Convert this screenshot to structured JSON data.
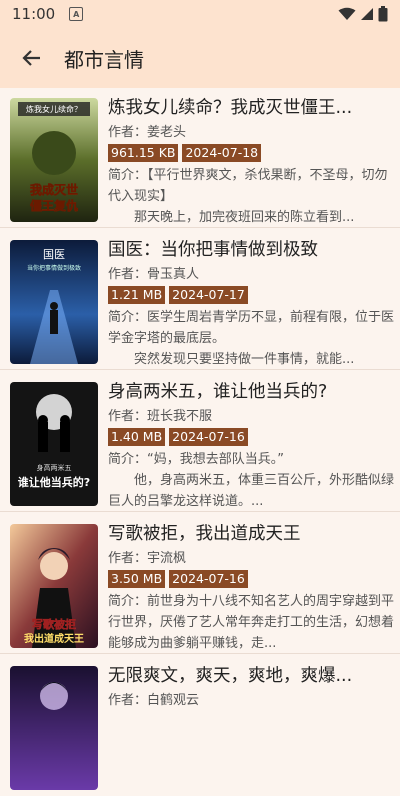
{
  "status": {
    "time": "11:00",
    "sim": "A"
  },
  "appbar": {
    "title": "都市言情"
  },
  "books": [
    {
      "title": "炼我女儿续命？我成灭世僵王...",
      "author": "作者：姜老头",
      "size": "961.15 KB",
      "date": "2024-07-18",
      "intro": "简介：【平行世界爽文，杀伐果断，不圣母，切勿代入现实】\n　　那天晚上，加完夜班回来的陈立看到...",
      "cover_title": "我成灭世僵王复仇",
      "cover_top": "炼我女儿续命？",
      "cover_colors": [
        "#2a2f1a",
        "#6b7a2e"
      ]
    },
    {
      "title": "国医：当你把事情做到极致",
      "author": "作者：骨玉真人",
      "size": "1.21 MB",
      "date": "2024-07-17",
      "intro": "简介：医学生周岩青学历不显，前程有限，位于医学金字塔的最底层。\n　　突然发现只要坚持做一件事情，就能...",
      "cover_title": "国医",
      "cover_top": "当你把事情做到极致",
      "cover_colors": [
        "#0c1b3a",
        "#2b5fa8"
      ]
    },
    {
      "title": "身高两米五，谁让他当兵的?",
      "author": "作者：班长我不服",
      "size": "1.40 MB",
      "date": "2024-07-16",
      "intro": "简介：“妈，我想去部队当兵。”\n　　他，身高两米五，体重三百公斤，外形酷似绿巨人的吕擎龙这样说道。...",
      "cover_title": "谁让他当兵的?",
      "cover_top": "身高两米五",
      "cover_colors": [
        "#111111",
        "#3a3a3a"
      ]
    },
    {
      "title": "写歌被拒，我出道成天王",
      "author": "作者：宇流枫",
      "size": "3.50 MB",
      "date": "2024-07-16",
      "intro": "简介：前世身为十八线不知名艺人的周宇穿越到平行世界，厌倦了艺人常年奔走打工的生活，幻想着能够成为曲爹躺平赚钱，走...",
      "cover_title": "写歌被拒 我出道成天王",
      "cover_top": "",
      "cover_colors": [
        "#3a1a2a",
        "#b86a3a"
      ]
    },
    {
      "title": "无限爽文，爽天，爽地，爽爆...",
      "author": "作者：白鹤观云",
      "size": "",
      "date": "",
      "intro": "",
      "cover_title": "",
      "cover_top": "",
      "cover_colors": [
        "#1a1030",
        "#6a3aa8"
      ]
    }
  ]
}
